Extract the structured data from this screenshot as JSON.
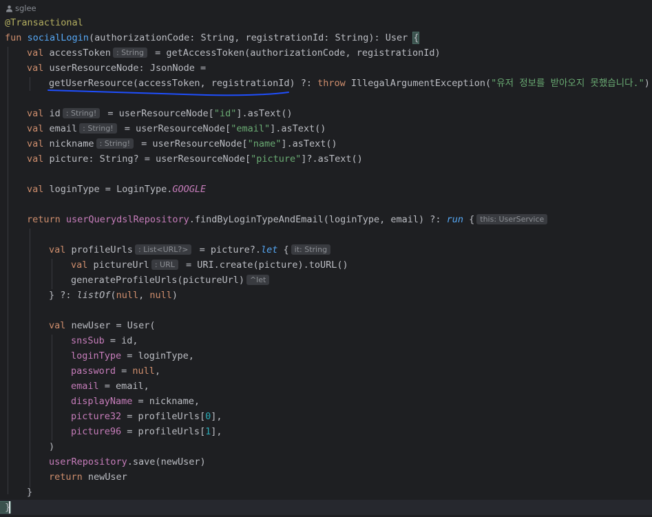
{
  "author": {
    "icon": "user-icon",
    "name": "sglee"
  },
  "code": {
    "annotation": "@Transactional",
    "fun_kw": "fun",
    "fun_name": "socialLogin",
    "fun_sig": "(authorizationCode: String, registrationId: String): User ",
    "open_brace": "{",
    "val": "val",
    "access_token_name": "accessToken",
    "hint_string": ": String",
    "access_token_rhs": " = getAccessToken(authorizationCode, registrationId)",
    "user_resource_decl": " userResourceNode: JsonNode =",
    "get_user_resource": "getUserResource(accessToken, registrationId)",
    "elvis": " ?: ",
    "throw_kw": "throw",
    "exception": " IllegalArgumentException(",
    "exception_msg": "\"유저 정보를 받아오지 못했습니다.\"",
    "close_paren": ")",
    "id_name": "id",
    "hint_string_bang": ": String!",
    "eq_node": " = userResourceNode[",
    "key_id": "\"id\"",
    "as_text": "].asText()",
    "email_name": "email",
    "key_email": "\"email\"",
    "nickname_name": "nickname",
    "key_name": "\"name\"",
    "picture_decl": "picture: String? = userResourceNode[",
    "key_picture": "\"picture\"",
    "as_text_safe": "]?.asText()",
    "login_type_decl": "loginType = LoginType.",
    "google": "GOOGLE",
    "return_kw": "return",
    "repo": "userQuerydslRepository",
    "find_call": ".findByLoginTypeAndEmail(loginType, email) ?: ",
    "run_kw": "run",
    "brace_space": " {",
    "hint_this": "this: UserService",
    "profile_urls_name": "profileUrls",
    "hint_list": ": List<URL?>",
    "eq_picture": " = picture?.",
    "let_kw": "let",
    "hint_it": "it: String",
    "picture_url_name": "pictureUrl",
    "hint_url": ": URL",
    "uri_call": " = URI.create(picture).toURL()",
    "gen_call": "generateProfileUrls(pictureUrl)",
    "hint_let": "^let",
    "close_let": "} ?: ",
    "list_of": "listOf",
    "open_paren": "(",
    "null_kw": "null",
    "comma_space": ", ",
    "new_user_decl": "newUser = User(",
    "sns_sub": "snsSub",
    "eq": " = ",
    "id_arg": "id,",
    "login_type_prop": "loginType",
    "login_type_arg": "loginType,",
    "password_prop": "password",
    "comma": ",",
    "email_prop": "email",
    "email_arg": "email,",
    "display_name_prop": "displayName",
    "nickname_arg": "nickname,",
    "picture32_prop": "picture32",
    "profile_urls_idx": "profileUrls[",
    "zero": "0",
    "one": "1",
    "idx_close": "],",
    "user_repo": "userRepository",
    "save_call": ".save(newUser)",
    "return_new_user": " newUser",
    "picture96_prop": "picture96",
    "close_brace": "}"
  },
  "colors": {
    "background": "#1e1f22",
    "keyword": "#cf8e6d",
    "function": "#56a8f5",
    "property": "#c77dbb",
    "string": "#6aab73",
    "number": "#2aacb8",
    "annotation": "#b3ae60",
    "pen_underline": "#1f4fff"
  }
}
